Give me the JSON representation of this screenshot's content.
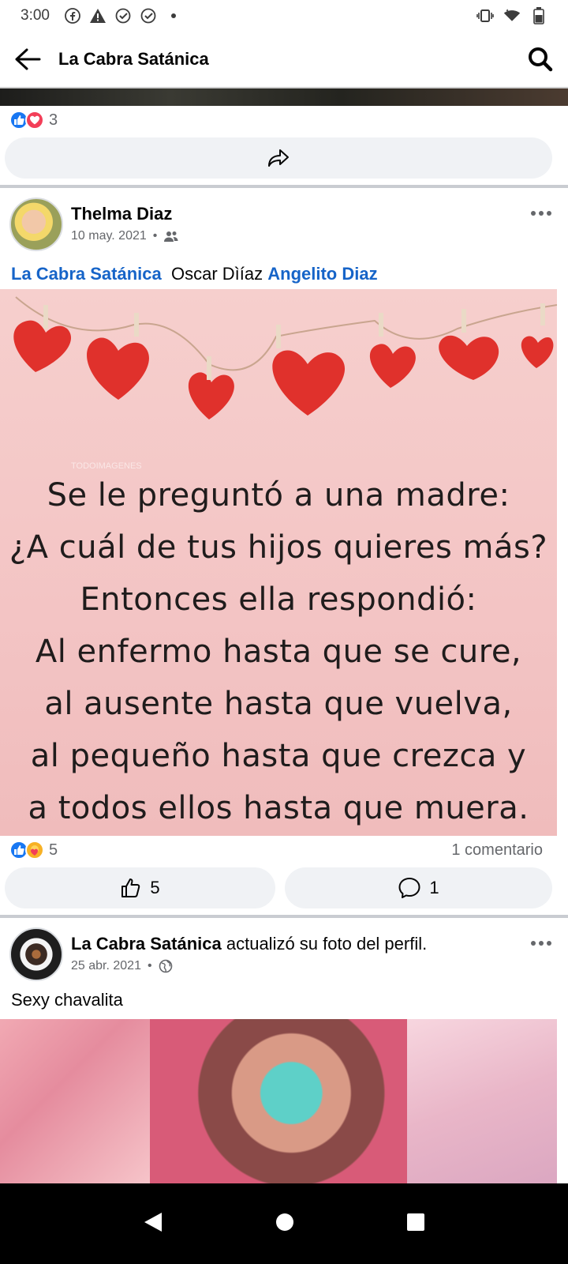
{
  "status_bar": {
    "time": "3:00"
  },
  "header": {
    "title": "La Cabra Satánica"
  },
  "prev_post": {
    "reaction_count": "3"
  },
  "post1": {
    "author": "Thelma Diaz",
    "date": "10 may. 2021",
    "separator": "•",
    "tags": {
      "page": "La Cabra Satánica",
      "plain": "Oscar Dìíaz",
      "friend": "Angelito Diaz"
    },
    "image_text": [
      "Se le preguntó a una madre:",
      "¿A cuál de tus hijos quieres más?",
      "Entonces ella respondió:",
      "Al enfermo hasta que se cure,",
      "al ausente hasta que vuelva,",
      "al pequeño hasta que crezca y",
      "a todos ellos hasta que muera."
    ],
    "image_watermark": "TODOIMAGENES",
    "reaction_count": "5",
    "comments_label": "1 comentario",
    "like_button_count": "5",
    "comment_button_count": "1"
  },
  "post2": {
    "author": "La Cabra Satánica",
    "action": " actualizó su foto del perfil.",
    "date": "25 abr. 2021",
    "separator": "•",
    "caption": "Sexy chavalita"
  },
  "colors": {
    "link": "#1664c8",
    "like": "#1877f2",
    "love": "#f33e58",
    "care": "#f7b125"
  }
}
